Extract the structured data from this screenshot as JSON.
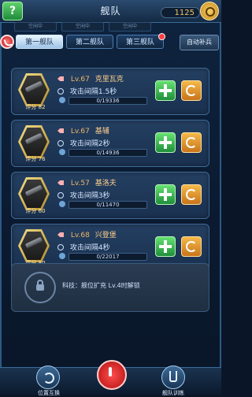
{
  "header": {
    "title": "舰队",
    "coins": "1125",
    "help_label": "?",
    "status": [
      "空闲中",
      "空闲中",
      "空闲中"
    ]
  },
  "tabs": [
    {
      "label": "第一舰队",
      "active": true
    },
    {
      "label": "第二舰队",
      "active": false
    },
    {
      "label": "第三舰队",
      "active": false,
      "badge": true
    }
  ],
  "auto_fill_label": "自动补兵",
  "ships": [
    {
      "level": "Lv.67",
      "name": "克里瓦克",
      "attack": "攻击间隔1.5秒",
      "progress_text": "0/19336",
      "score": "评分 82"
    },
    {
      "level": "Lv.67",
      "name": "基辅",
      "attack": "攻击间隔2秒",
      "progress_text": "0/14936",
      "score": "评分 76"
    },
    {
      "level": "Lv.57",
      "name": "基洛夫",
      "attack": "攻击间隔3秒",
      "progress_text": "0/11470",
      "score": "评分 60"
    },
    {
      "level": "Lv.68",
      "name": "兴登堡",
      "attack": "攻击间隔4秒",
      "progress_text": "0/22017",
      "score": "评分 80"
    }
  ],
  "locked_slot": {
    "text": "科技：舰位扩充 Lv.4时解锁"
  },
  "bottom": {
    "left_label": "位置互换",
    "right_label": "舰队训练"
  },
  "colors": {
    "accent": "#2b5a86",
    "green": "#1f8f3a",
    "orange": "#c9741a",
    "red": "#b01010"
  }
}
